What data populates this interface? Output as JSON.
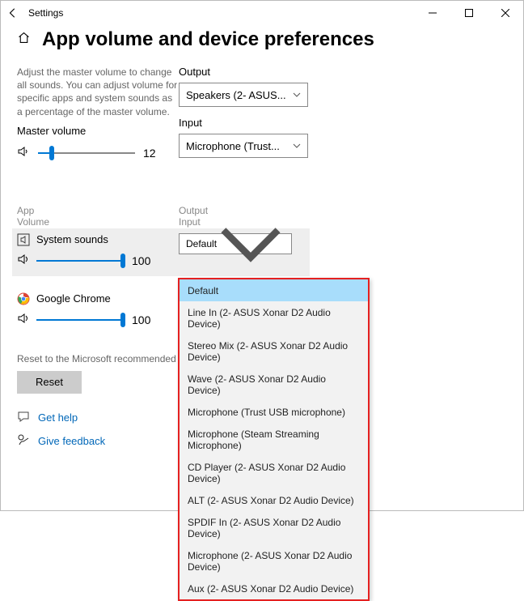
{
  "window": {
    "title": "Settings"
  },
  "page": {
    "title": "App volume and device preferences",
    "description": "Adjust the master volume to change all sounds. You can adjust volume for specific apps and system sounds as a percentage of the master volume.",
    "master_volume_label": "Master volume",
    "master_volume_value": "12",
    "master_volume_pct": 12
  },
  "devices": {
    "output_label": "Output",
    "output_value": "Speakers (2- ASUS...",
    "input_label": "Input",
    "input_value": "Microphone (Trust..."
  },
  "columns": {
    "app_line1": "App",
    "app_line2": "Volume",
    "oi_line1": "Output",
    "oi_line2": "Input"
  },
  "apps": {
    "system": {
      "name": "System sounds",
      "volume": "100",
      "pct": 100,
      "output_value": "Default"
    },
    "chrome": {
      "name": "Google Chrome",
      "volume": "100",
      "pct": 100
    }
  },
  "dropdown": {
    "items": [
      "Default",
      "Line In (2- ASUS Xonar D2 Audio Device)",
      "Stereo Mix (2- ASUS Xonar D2 Audio Device)",
      "Wave (2- ASUS Xonar D2 Audio Device)",
      "Microphone (Trust USB microphone)",
      "Microphone (Steam Streaming Microphone)",
      "CD Player (2- ASUS Xonar D2 Audio Device)",
      "ALT (2- ASUS Xonar D2 Audio Device)",
      "SPDIF In (2- ASUS Xonar D2 Audio Device)",
      "Microphone (2- ASUS Xonar D2 Audio Device)",
      "Aux (2- ASUS Xonar D2 Audio Device)"
    ]
  },
  "reset": {
    "text": "Reset to the Microsoft recommended defaul",
    "button": "Reset"
  },
  "footer": {
    "help": "Get help",
    "feedback": "Give feedback"
  }
}
